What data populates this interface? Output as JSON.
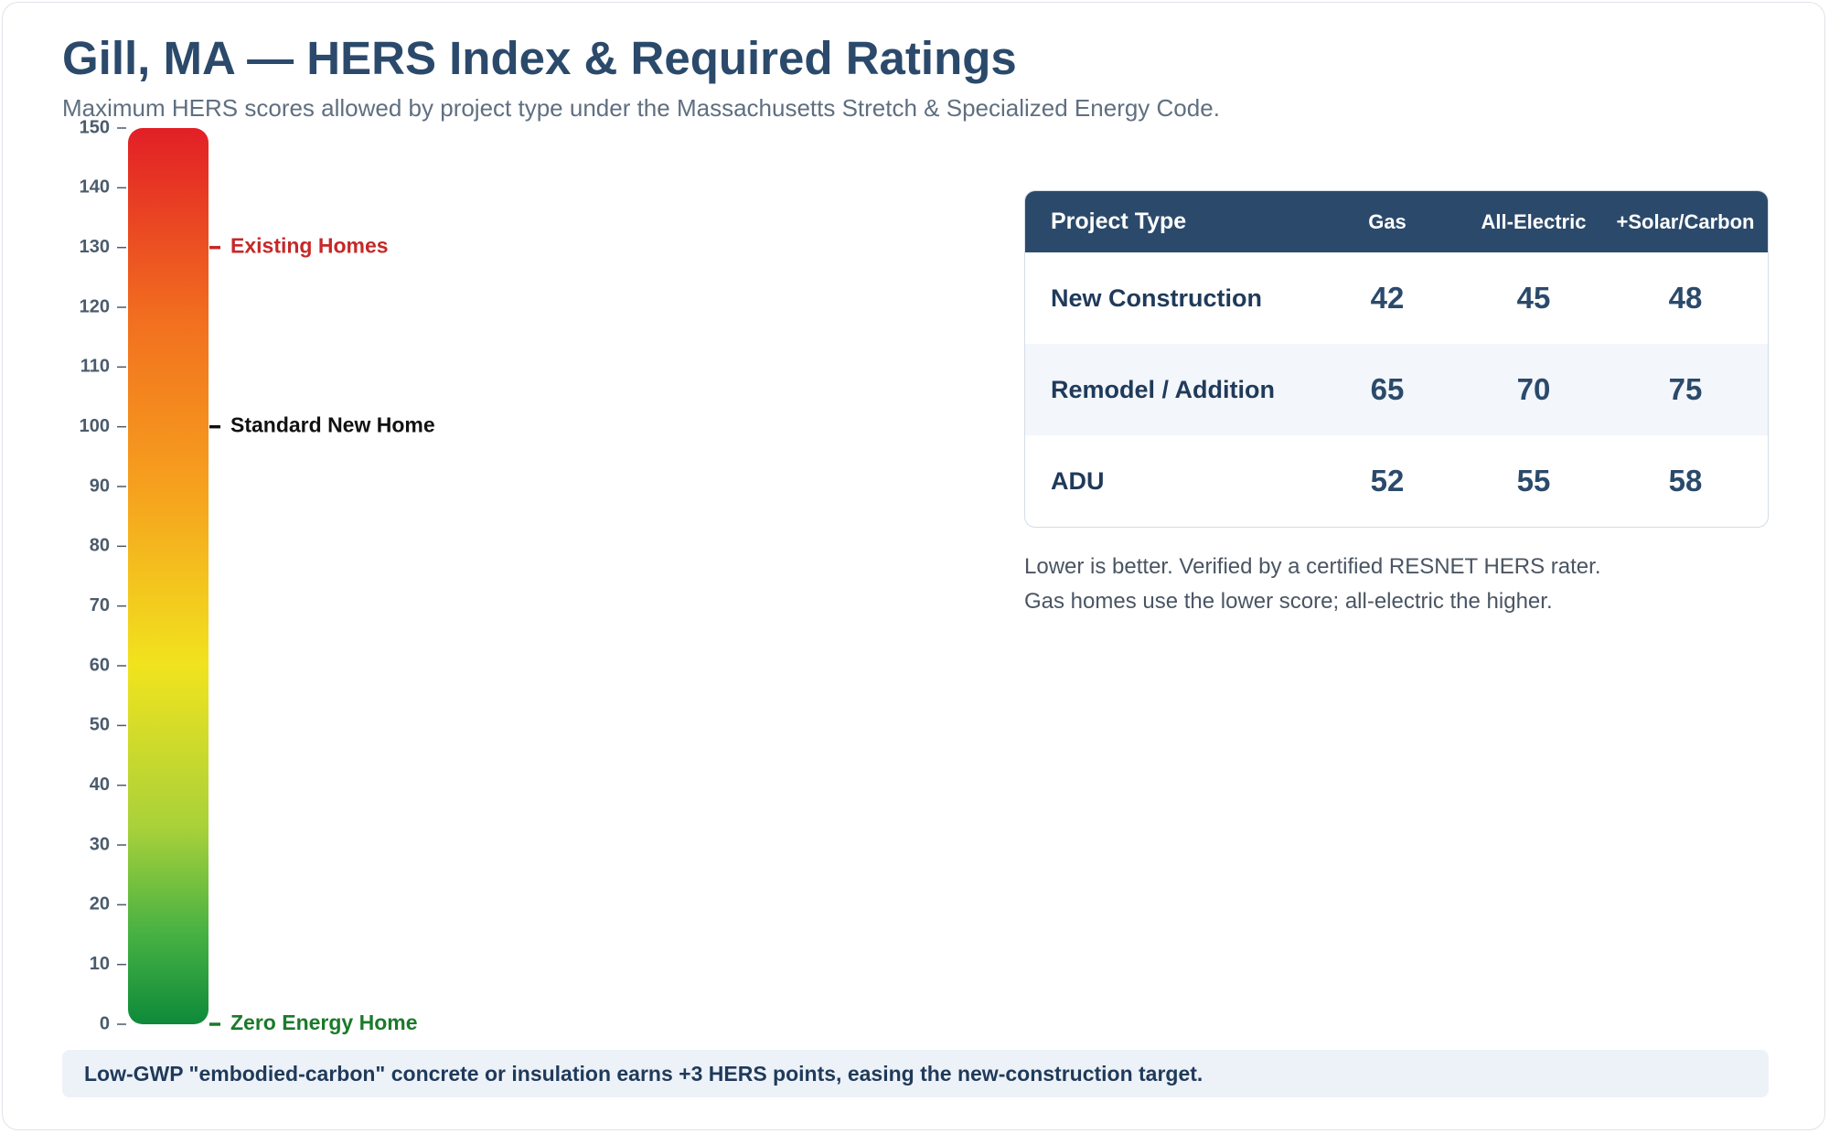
{
  "header": {
    "title": "Gill, MA — HERS Index & Required Ratings",
    "subtitle": "Maximum HERS scores allowed by project type under the Massachusetts Stretch & Specialized Energy Code."
  },
  "chart_data": {
    "type": "bar",
    "title": "",
    "ylim": [
      0,
      150
    ],
    "ticks": [
      0,
      10,
      20,
      30,
      40,
      50,
      60,
      70,
      80,
      90,
      100,
      110,
      120,
      130,
      140,
      150
    ],
    "gradient": "green (0) to yellow (~80) to orange to red (150)",
    "markers": [
      {
        "label": "Existing Homes",
        "value": 130,
        "color": "#c62828"
      },
      {
        "label": "Standard New Home",
        "value": 100,
        "color": "#111111"
      },
      {
        "label": "Zero Energy Home",
        "value": 0,
        "color": "#1b7a2a"
      }
    ],
    "colors": {
      "axis": "#4b5b6c",
      "red": "#e21f26",
      "orange": "#f58220",
      "yellow": "#f1e31e",
      "green": "#0e8a3a"
    }
  },
  "table": {
    "headers": [
      "Project Type",
      "Gas",
      "All-Electric",
      "+Solar/Carbon"
    ],
    "rows": [
      {
        "type": "New Construction",
        "gas": "42",
        "electric": "45",
        "solar": "48"
      },
      {
        "type": "Remodel / Addition",
        "gas": "65",
        "electric": "70",
        "solar": "75"
      },
      {
        "type": "ADU",
        "gas": "52",
        "electric": "55",
        "solar": "58"
      }
    ]
  },
  "notes": {
    "line1": "Lower is better. Verified by a certified RESNET HERS rater.",
    "line2": "Gas homes use the lower score; all-electric the higher."
  },
  "footnote": "Low-GWP \"embodied-carbon\" concrete or insulation earns +3 HERS points, easing the new-construction target.",
  "colors": {
    "title": "#2b4a6b",
    "table_header_bg": "#2b4a6b",
    "footnote_bg": "#edf2f8"
  }
}
